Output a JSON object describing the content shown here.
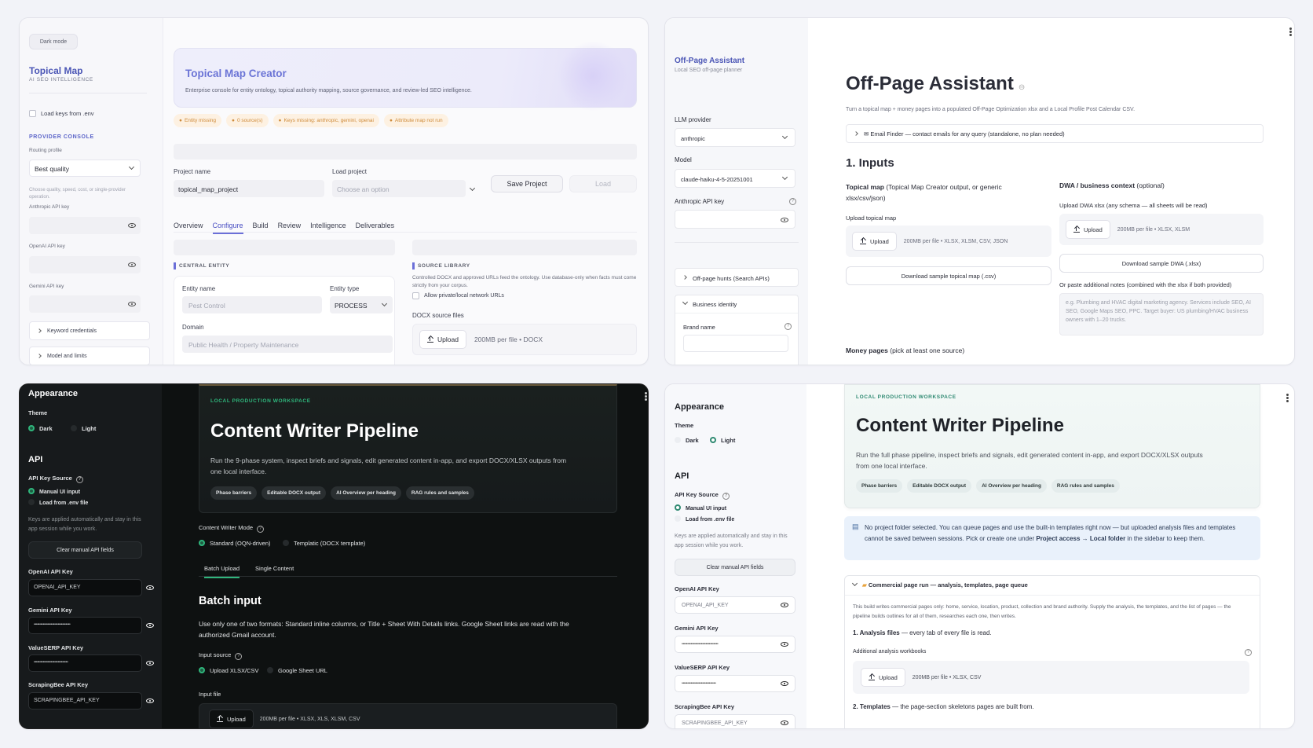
{
  "panel_a": {
    "dark_mode_button": "Dark mode",
    "brand_title": "Topical Map",
    "brand_subtitle": "AI SEO INTELLIGENCE",
    "load_keys_label": "Load keys from .env",
    "provider_console": "PROVIDER CONSOLE",
    "routing_profile_label": "Routing profile",
    "routing_profile_value": "Best quality",
    "routing_help": "Choose quality, speed, cost, or single-provider operation.",
    "anthropic_key_label": "Anthropic API key",
    "openai_key_label": "OpenAI API key",
    "gemini_key_label": "Gemini API key",
    "keyword_credentials": "Keyword credentials",
    "model_and_limits": "Model and limits",
    "hero_title": "Topical Map Creator",
    "hero_subtitle": "Enterprise console for entity ontology, topical authority mapping, source governance, and review-led SEO intelligence.",
    "chips": [
      "Entity missing",
      "0 source(s)",
      "Keys missing: anthropic, gemini, openai",
      "Attribute map not run"
    ],
    "project_name_label": "Project name",
    "project_name_value": "topical_map_project",
    "load_project_label": "Load project",
    "load_project_placeholder": "Choose an option",
    "save_project": "Save Project",
    "load_button": "Load",
    "tabs": [
      "Overview",
      "Configure",
      "Build",
      "Review",
      "Intelligence",
      "Deliverables"
    ],
    "central_entity": "CENTRAL ENTITY",
    "entity_name_label": "Entity name",
    "entity_name_placeholder": "Pest Control",
    "entity_type_label": "Entity type",
    "entity_type_value": "PROCESS",
    "domain_label": "Domain",
    "domain_placeholder": "Public Health / Property Maintenance",
    "source_library": "SOURCE LIBRARY",
    "source_help": "Controlled DOCX and approved URLs feed the ontology. Use database-only when facts must come strictly from your corpus.",
    "allow_private": "Allow private/local network URLs",
    "docx_label": "DOCX source files",
    "upload": "Upload",
    "docx_limit": "200MB per file • DOCX"
  },
  "panel_b": {
    "brand_title": "Off-Page Assistant",
    "brand_subtitle": "Local SEO off-page planner",
    "llm_provider_label": "LLM provider",
    "llm_provider_value": "anthropic",
    "model_label": "Model",
    "model_value": "claude-haiku-4-5-20251001",
    "anthropic_key_label": "Anthropic API key",
    "offpage_hunts": "Off-page hunts (Search APIs)",
    "business_identity": "Business identity",
    "brand_name_label": "Brand name",
    "title": "Off-Page Assistant",
    "subtitle": "Turn a topical map + money pages into a populated Off-Page Optimization xlsx and a Local Profile Post Calendar CSV.",
    "email_finder": "Email Finder — contact emails for any query (standalone, no plan needed)",
    "inputs_heading": "1. Inputs",
    "topical_map_bold": "Topical map",
    "topical_map_rest": "(Topical Map Creator output, or generic xlsx/csv/json)",
    "upload_topical_map": "Upload topical map",
    "upload": "Upload",
    "topical_limit": "200MB per file • XLSX, XLSM, CSV, JSON",
    "download_topical": "Download sample topical map (.csv)",
    "dwa_bold": "DWA / business context",
    "dwa_rest": "(optional)",
    "upload_dwa": "Upload DWA xlsx (any schema — all sheets will be read)",
    "dwa_limit": "200MB per file • XLSX, XLSM",
    "download_dwa": "Download sample DWA (.xlsx)",
    "paste_notes": "Or paste additional notes (combined with the xlsx if both provided)",
    "notes_placeholder": "e.g. Plumbing and HVAC digital marketing agency. Services include SEO, AI SEO, Google Maps SEO, PPC. Target buyer: US plumbing/HVAC business owners with 1–20 trucks.",
    "money_pages_bold": "Money pages",
    "money_pages_rest": "(pick at least one source)"
  },
  "panel_c": {
    "appearance": "Appearance",
    "theme": "Theme",
    "dark": "Dark",
    "light": "Light",
    "api": "API",
    "api_key_source": "API Key Source",
    "manual_ui": "Manual UI input",
    "load_env": "Load from .env file",
    "keys_note": "Keys are applied automatically and stay in this app session while you work.",
    "clear_fields": "Clear manual API fields",
    "openai_label": "OpenAI API Key",
    "openai_value": "OPENAI_API_KEY",
    "gemini_label": "Gemini API Key",
    "gemini_value": "••••••••••••••••••••••••••••••••",
    "valueserp_label": "ValueSERP API Key",
    "valueserp_value": "••••••••••••••••••••••••••••••",
    "scrapingbee_label": "ScrapingBee API Key",
    "scrapingbee_value": "SCRAPINGBEE_API_KEY",
    "eyebrow": "LOCAL PRODUCTION WORKSPACE",
    "title": "Content Writer Pipeline",
    "subtitle": "Run the 9-phase system, inspect briefs and signals, edit generated content in-app, and export DOCX/XLSX outputs from one local interface.",
    "chips": [
      "Phase barriers",
      "Editable DOCX output",
      "AI Overview per heading",
      "RAG rules and samples"
    ],
    "mode_label": "Content Writer Mode",
    "mode_standard": "Standard (OQN-driven)",
    "mode_templatic": "Templatic (DOCX template)",
    "tab_batch": "Batch Upload",
    "tab_single": "Single Content",
    "batch_heading": "Batch input",
    "batch_desc": "Use only one of two formats: Standard inline columns, or Title + Sheet With Details links. Google Sheet links are read with the authorized Gmail account.",
    "input_source": "Input source",
    "upload_xlsx_csv": "Upload XLSX/CSV",
    "google_sheet_url": "Google Sheet URL",
    "input_file": "Input file",
    "upload": "Upload",
    "file_limit": "200MB per file • XLSX, XLS, XLSM, CSV",
    "accent": "#2fb67c"
  },
  "panel_d": {
    "appearance": "Appearance",
    "theme": "Theme",
    "dark": "Dark",
    "light": "Light",
    "api": "API",
    "api_key_source": "API Key Source",
    "manual_ui": "Manual UI input",
    "load_env": "Load from .env file",
    "keys_note": "Keys are applied automatically and stay in this app session while you work.",
    "clear_fields": "Clear manual API fields",
    "openai_label": "OpenAI API Key",
    "openai_value": "OPENAI_API_KEY",
    "gemini_label": "Gemini API Key",
    "gemini_value": "••••••••••••••••••••••••••••••••",
    "valueserp_label": "ValueSERP API Key",
    "valueserp_value": "••••••••••••••••••••••••••••••",
    "scrapingbee_label": "ScrapingBee API Key",
    "scrapingbee_value": "SCRAPINGBEE_API_KEY",
    "eyebrow": "LOCAL PRODUCTION WORKSPACE",
    "title": "Content Writer Pipeline",
    "subtitle": "Run the full phase pipeline, inspect briefs and signals, edit generated content in-app, and export DOCX/XLSX outputs from one local interface.",
    "chips": [
      "Phase barriers",
      "Editable DOCX output",
      "AI Overview per heading",
      "RAG rules and samples"
    ],
    "notice_a": "No project folder selected. You can queue pages and use the built-in templates right now — but uploaded analysis files and templates cannot be saved between sessions. Pick or create one under ",
    "notice_b": "Project access → Local folder",
    "notice_c": " in the sidebar to keep them.",
    "expander_title": "Commercial page run — analysis, templates, page queue",
    "expander_desc": "This build writes commercial pages only: home, service, location, product, collection and brand authority. Supply the analysis, the templates, and the list of pages — the pipeline builds outlines for all of them, researches each one, then writes.",
    "analysis_files_bold": "1. Analysis files",
    "analysis_files_rest": " — every tab of every file is read.",
    "additional_workbooks": "Additional analysis workbooks",
    "upload": "Upload",
    "file_limit": "200MB per file • XLSX, CSV",
    "templates_bold": "2. Templates",
    "templates_rest": " — the page-section skeletons pages are built from.",
    "accent": "#2f8a72"
  }
}
